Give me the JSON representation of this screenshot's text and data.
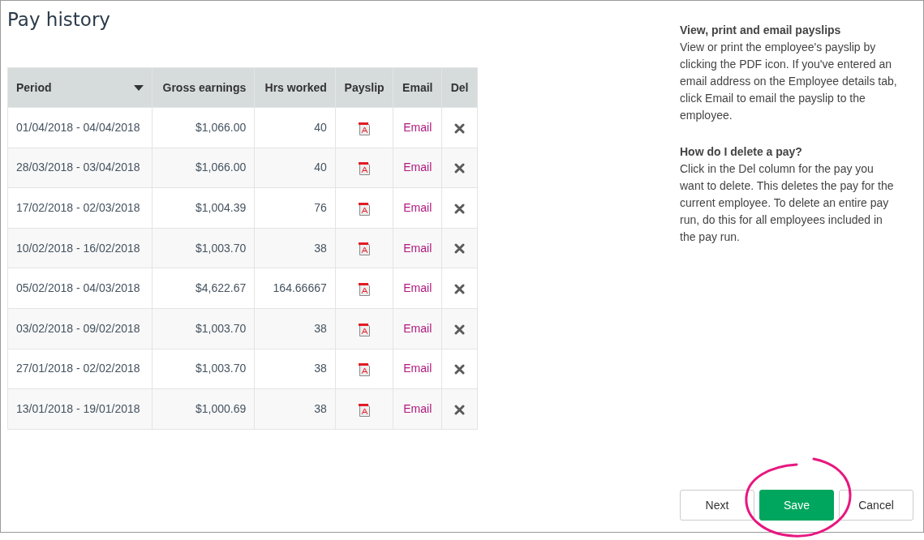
{
  "title": "Pay history",
  "table": {
    "columns": [
      {
        "label": "Period",
        "sorted": true
      },
      {
        "label": "Gross earnings",
        "sorted": false
      },
      {
        "label": "Hrs worked",
        "sorted": false
      },
      {
        "label": "Payslip",
        "sorted": false
      },
      {
        "label": "Email",
        "sorted": false
      },
      {
        "label": "Del",
        "sorted": false
      }
    ],
    "rows": [
      {
        "period": "01/04/2018 - 04/04/2018",
        "gross": "$1,066.00",
        "hours": "40",
        "email": "Email"
      },
      {
        "period": "28/03/2018 - 03/04/2018",
        "gross": "$1,066.00",
        "hours": "40",
        "email": "Email"
      },
      {
        "period": "17/02/2018 - 02/03/2018",
        "gross": "$1,004.39",
        "hours": "76",
        "email": "Email"
      },
      {
        "period": "10/02/2018 - 16/02/2018",
        "gross": "$1,003.70",
        "hours": "38",
        "email": "Email"
      },
      {
        "period": "05/02/2018 - 04/03/2018",
        "gross": "$4,622.67",
        "hours": "164.66667",
        "email": "Email"
      },
      {
        "period": "03/02/2018 - 09/02/2018",
        "gross": "$1,003.70",
        "hours": "38",
        "email": "Email"
      },
      {
        "period": "27/01/2018 - 02/02/2018",
        "gross": "$1,003.70",
        "hours": "38",
        "email": "Email"
      },
      {
        "period": "13/01/2018 - 19/01/2018",
        "gross": "$1,000.69",
        "hours": "38",
        "email": "Email"
      }
    ]
  },
  "help": [
    {
      "heading": "View, print and email payslips",
      "text": "View or print the employee's payslip by clicking the PDF icon. If you've entered an email address on the Employee details tab, click Email to email the payslip to the employee."
    },
    {
      "heading": "How do I delete a pay?",
      "text": "Click in the Del column for the pay you want to delete. This deletes the pay for the current employee. To delete an entire pay run, do this for all employees included in the pay run."
    }
  ],
  "buttons": [
    {
      "label": "Next",
      "kind": "secondary",
      "highlighted": false
    },
    {
      "label": "Save",
      "kind": "primary",
      "highlighted": true
    },
    {
      "label": "Cancel",
      "kind": "secondary",
      "highlighted": false
    }
  ]
}
